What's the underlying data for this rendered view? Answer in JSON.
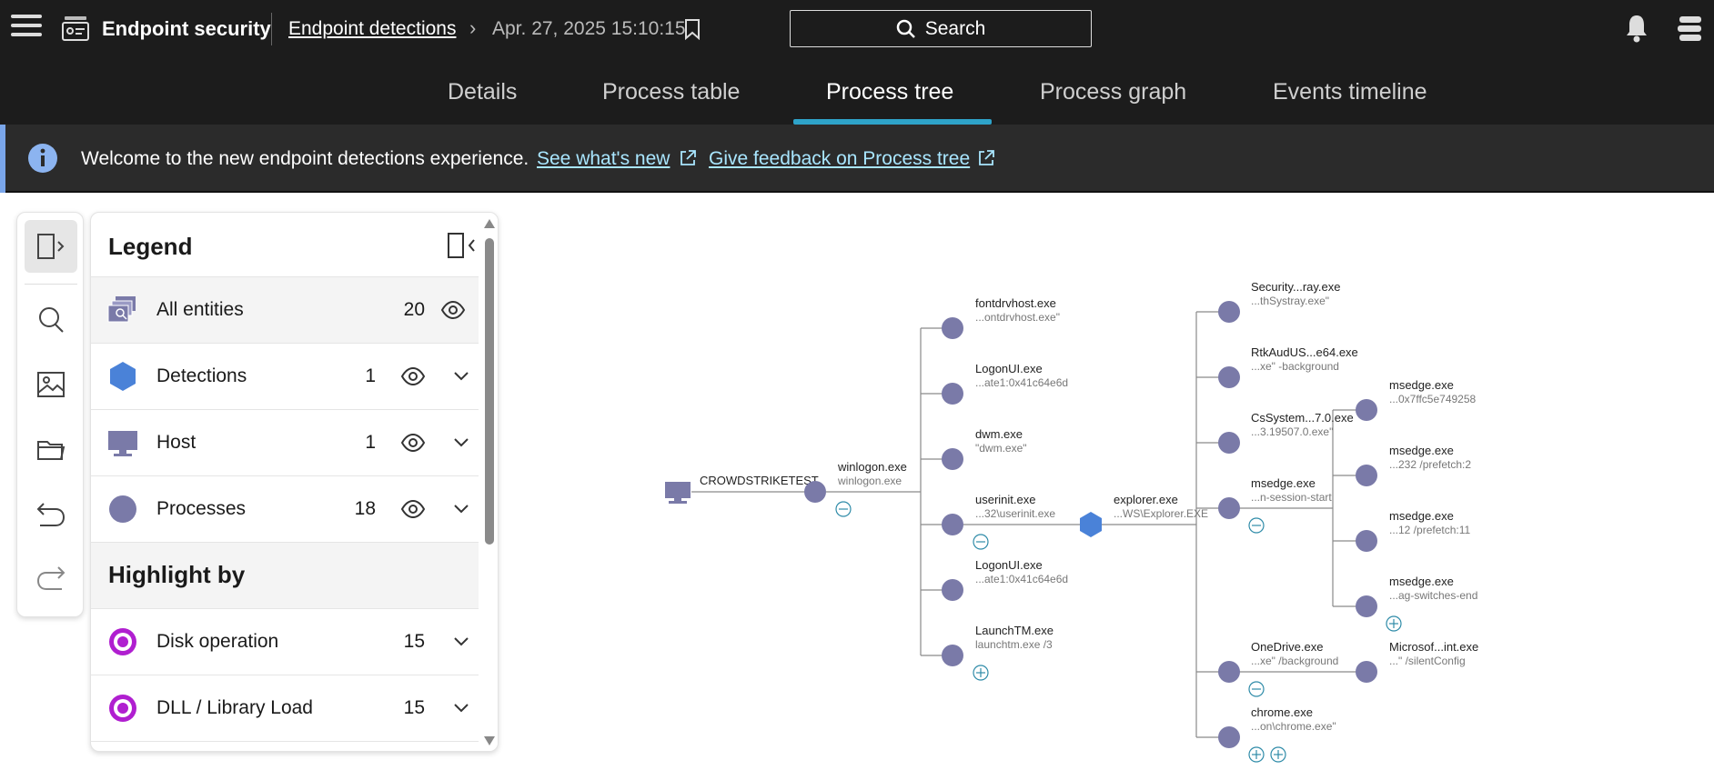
{
  "header": {
    "app_title": "Endpoint security",
    "breadcrumb_link": "Endpoint detections",
    "breadcrumb_date": "Apr. 27, 2025 15:10:15",
    "search_label": "Search"
  },
  "tabs": [
    {
      "label": "Details"
    },
    {
      "label": "Process table"
    },
    {
      "label": "Process tree",
      "active": true
    },
    {
      "label": "Process graph"
    },
    {
      "label": "Events timeline"
    }
  ],
  "banner": {
    "text": "Welcome to the new endpoint detections experience.",
    "link1": "See what's new",
    "link2": "Give feedback on Process tree"
  },
  "rail": {
    "icons": [
      "panel-toggle-icon",
      "search-icon",
      "image-icon",
      "folder-icon",
      "undo-icon",
      "redo-icon"
    ]
  },
  "legend": {
    "title": "Legend",
    "rows": [
      {
        "label": "All entities",
        "count": "20",
        "icon": "all-entities-icon"
      },
      {
        "label": "Detections",
        "count": "1",
        "icon": "detection-hexagon-icon"
      },
      {
        "label": "Host",
        "count": "1",
        "icon": "host-monitor-icon"
      },
      {
        "label": "Processes",
        "count": "18",
        "icon": "process-circle-icon"
      }
    ],
    "highlight_title": "Highlight by",
    "highlight_rows": [
      {
        "label": "Disk operation",
        "count": "15",
        "icon": "target-icon"
      },
      {
        "label": "DLL / Library Load",
        "count": "15",
        "icon": "target-icon"
      }
    ]
  },
  "colors": {
    "process_node": "#7a7aa8",
    "detection_node": "#4a82d8",
    "accent": "#2ea3c9",
    "highlight": "#b01fd0"
  },
  "tree": {
    "host": {
      "label": "CROWDSTRIKETEST"
    },
    "winlogon": {
      "name": "winlogon.exe",
      "cmd": "winlogon.exe"
    },
    "level2": [
      {
        "name": "fontdrvhost.exe",
        "cmd": "...ontdrvhost.exe\""
      },
      {
        "name": "LogonUI.exe",
        "cmd": "...ate1:0x41c64e6d"
      },
      {
        "name": "dwm.exe",
        "cmd": "\"dwm.exe\""
      },
      {
        "name": "userinit.exe",
        "cmd": "...32\\userinit.exe"
      },
      {
        "name": "LogonUI.exe",
        "cmd": "...ate1:0x41c64e6d"
      },
      {
        "name": "LaunchTM.exe",
        "cmd": "launchtm.exe /3"
      }
    ],
    "explorer": {
      "name": "explorer.exe",
      "cmd": "...WS\\Explorer.EXE"
    },
    "level3": [
      {
        "name": "Security...ray.exe",
        "cmd": "...thSystray.exe\""
      },
      {
        "name": "RtkAudUS...e64.exe",
        "cmd": "...xe\" -background"
      },
      {
        "name": "CsSystem...7.0.exe",
        "cmd": "...3.19507.0.exe\""
      },
      {
        "name": "msedge.exe",
        "cmd": "...n-session-start"
      },
      {
        "name": "OneDrive.exe",
        "cmd": "...xe\" /background"
      },
      {
        "name": "chrome.exe",
        "cmd": "...on\\chrome.exe\""
      }
    ],
    "level4": [
      {
        "name": "msedge.exe",
        "cmd": "...0x7ffc5e749258"
      },
      {
        "name": "msedge.exe",
        "cmd": "...232 /prefetch:2"
      },
      {
        "name": "msedge.exe",
        "cmd": "...12 /prefetch:11"
      },
      {
        "name": "msedge.exe",
        "cmd": "...ag-switches-end"
      },
      {
        "name": "Microsof...int.exe",
        "cmd": "...\" /silentConfig"
      }
    ]
  }
}
